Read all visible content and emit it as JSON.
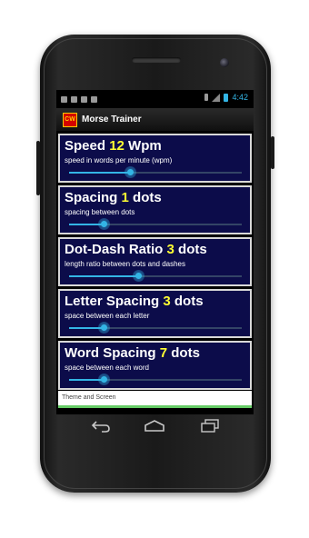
{
  "status_bar": {
    "time": "4:42",
    "icons": [
      "notification-icon",
      "download-icon",
      "usb-icon",
      "android-icon"
    ]
  },
  "app": {
    "icon_text": "CW",
    "title": "Morse Trainer"
  },
  "settings": [
    {
      "name": "Speed",
      "value": "12",
      "unit": "Wpm",
      "description": "speed in words per minute (wpm)",
      "level": 0.35
    },
    {
      "name": "Spacing",
      "value": "1",
      "unit": "dots",
      "description": "spacing between dots",
      "level": 0.2
    },
    {
      "name": "Dot-Dash Ratio",
      "value": "3",
      "unit": "dots",
      "description": "length ratio between dots and dashes",
      "level": 0.4
    },
    {
      "name": "Letter Spacing",
      "value": "3",
      "unit": "dots",
      "description": "space between each letter",
      "level": 0.2
    },
    {
      "name": "Word Spacing",
      "value": "7",
      "unit": "dots",
      "description": "space between each word",
      "level": 0.2
    }
  ],
  "footer": {
    "label": "Theme and Screen"
  },
  "colors": {
    "accent": "#33b5e5",
    "value": "#ffff33",
    "panel": "#0c0c4a"
  }
}
